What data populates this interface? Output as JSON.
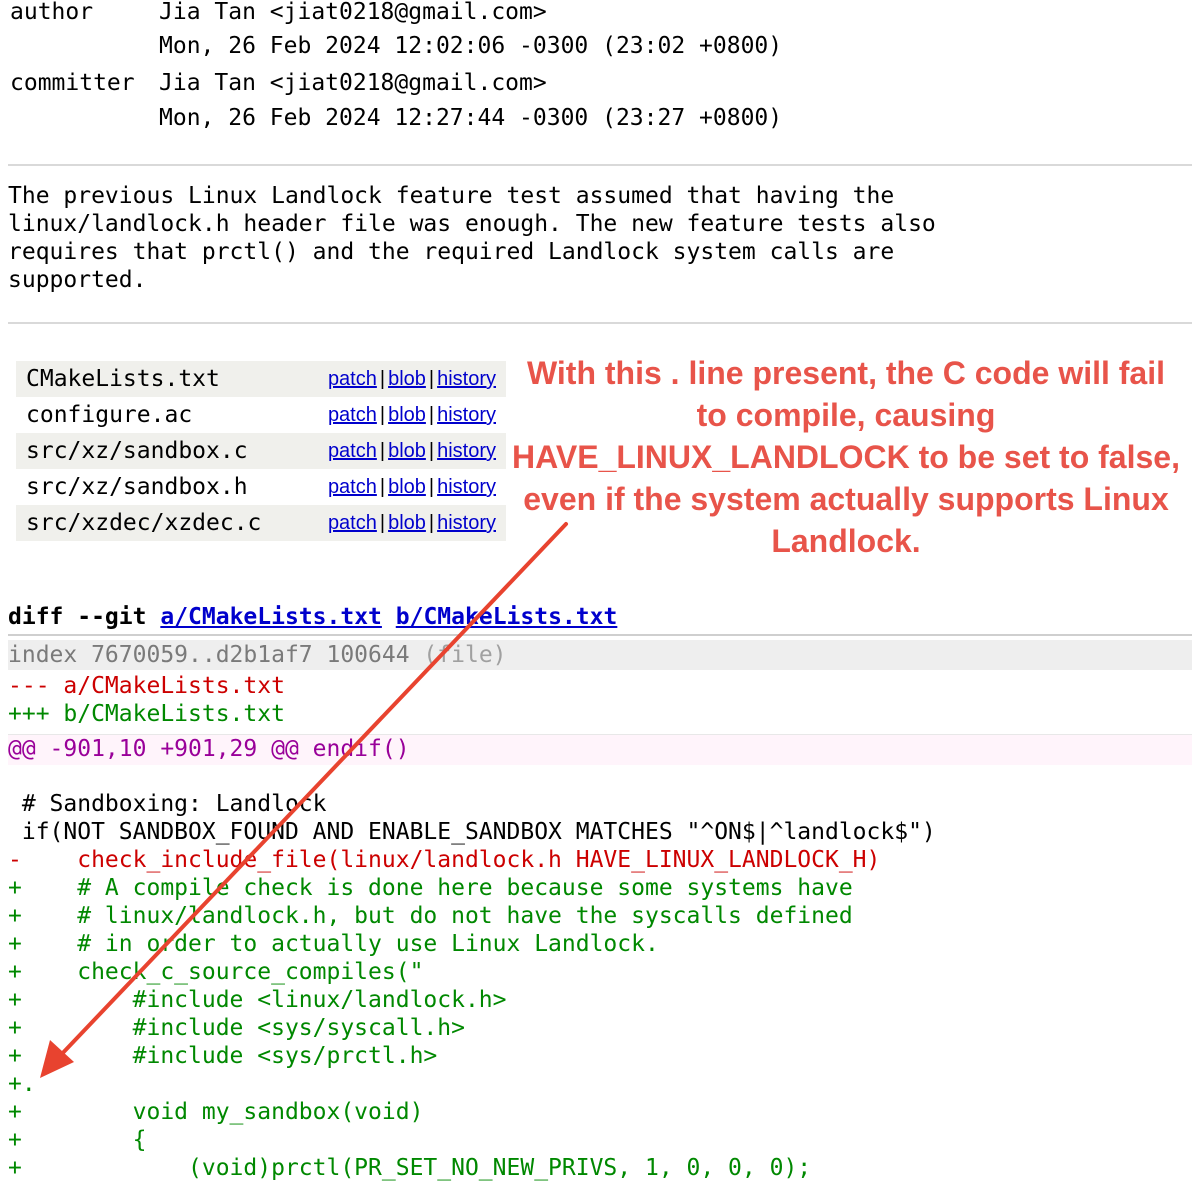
{
  "meta": {
    "author_label": "author",
    "author_value": "Jia Tan <jiat0218@gmail.com>",
    "author_date": "Mon, 26 Feb 2024 12:02:06 -0300 (23:02 +0800)",
    "committer_label": "committer",
    "committer_value": "Jia Tan <jiat0218@gmail.com>",
    "committer_date": "Mon, 26 Feb 2024 12:27:44 -0300 (23:27 +0800)"
  },
  "message": "The previous Linux Landlock feature test assumed that having the\nlinux/landlock.h header file was enough. The new feature tests also\nrequires that prctl() and the required Landlock system calls are\nsupported.",
  "files": [
    {
      "name": "CMakeLists.txt"
    },
    {
      "name": "configure.ac"
    },
    {
      "name": "src/xz/sandbox.c"
    },
    {
      "name": "src/xz/sandbox.h"
    },
    {
      "name": "src/xzdec/xzdec.c"
    }
  ],
  "file_links": {
    "patch": "patch",
    "blob": "blob",
    "history": "history",
    "separator": "|"
  },
  "annotation": "With this . line present, the C code will fail to compile, causing HAVE_LINUX_LANDLOCK to be set to false, even if the system actually supports Linux Landlock.",
  "diff": {
    "header_prefix": "diff --git",
    "link_a": "a/CMakeLists.txt",
    "link_b": "b/CMakeLists.txt",
    "index": "index 7670059..d2b1af7 100644",
    "index_suffix": " (file)",
    "minus_file": "--- a/CMakeLists.txt",
    "plus_file": "+++ b/CMakeLists.txt",
    "hunk": "@@ -901,10 +901,29 @@ endif()",
    "lines": [
      {
        "kind": "ctx",
        "text": ""
      },
      {
        "kind": "ctx",
        "text": " # Sandboxing: Landlock"
      },
      {
        "kind": "ctx",
        "text": " if(NOT SANDBOX_FOUND AND ENABLE_SANDBOX MATCHES \"^ON$|^landlock$\")"
      },
      {
        "kind": "del",
        "text": "-    check_include_file(linux/landlock.h HAVE_LINUX_LANDLOCK_H)"
      },
      {
        "kind": "add",
        "text": "+    # A compile check is done here because some systems have"
      },
      {
        "kind": "add",
        "text": "+    # linux/landlock.h, but do not have the syscalls defined"
      },
      {
        "kind": "add",
        "text": "+    # in order to actually use Linux Landlock."
      },
      {
        "kind": "add",
        "text": "+    check_c_source_compiles(\""
      },
      {
        "kind": "add",
        "text": "+        #include <linux/landlock.h>"
      },
      {
        "kind": "add",
        "text": "+        #include <sys/syscall.h>"
      },
      {
        "kind": "add",
        "text": "+        #include <sys/prctl.h>"
      },
      {
        "kind": "add",
        "text": "+."
      },
      {
        "kind": "add",
        "text": "+        void my_sandbox(void)"
      },
      {
        "kind": "add",
        "text": "+        {"
      },
      {
        "kind": "add",
        "text": "+            (void)prctl(PR_SET_NO_NEW_PRIVS, 1, 0, 0, 0);"
      }
    ]
  },
  "colors": {
    "annotation": "#e8544a",
    "arrow": "#e8432f",
    "deleted": "#cc0000",
    "added": "#008800",
    "hunk": "#990099",
    "link": "#0000cc"
  }
}
